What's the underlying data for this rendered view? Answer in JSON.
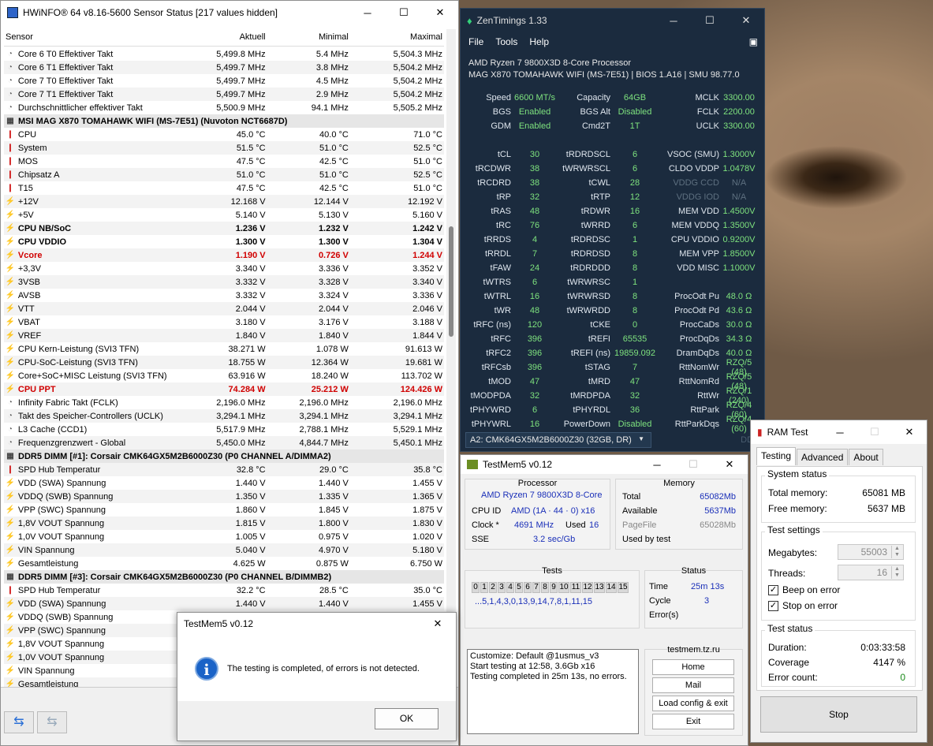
{
  "hwinfo": {
    "title": "HWiNFO® 64 v8.16-5600 Sensor Status [217 values hidden]",
    "columns": [
      "Sensor",
      "Aktuell",
      "Minimal",
      "Maximal"
    ],
    "rows": [
      {
        "t": "clock",
        "name": "Core 6 T0 Effektiver Takt",
        "a": "5,499.8 MHz",
        "b": "5.4 MHz",
        "c": "5,504.3 MHz"
      },
      {
        "t": "clock",
        "name": "Core 6 T1 Effektiver Takt",
        "a": "5,499.7 MHz",
        "b": "3.8 MHz",
        "c": "5,504.2 MHz"
      },
      {
        "t": "clock",
        "name": "Core 7 T0 Effektiver Takt",
        "a": "5,499.7 MHz",
        "b": "4.5 MHz",
        "c": "5,504.2 MHz"
      },
      {
        "t": "clock",
        "name": "Core 7 T1 Effektiver Takt",
        "a": "5,499.7 MHz",
        "b": "2.9 MHz",
        "c": "5,504.2 MHz"
      },
      {
        "t": "clock",
        "name": "Durchschnittlicher effektiver Takt",
        "a": "5,500.9 MHz",
        "b": "94.1 MHz",
        "c": "5,505.2 MHz"
      },
      {
        "t": "hdr",
        "name": "MSI MAG X870 TOMAHAWK WIFI (MS-7E51) (Nuvoton NCT6687D)",
        "a": "",
        "b": "",
        "c": ""
      },
      {
        "t": "temp",
        "name": "CPU",
        "a": "45.0 °C",
        "b": "40.0 °C",
        "c": "71.0 °C"
      },
      {
        "t": "temp",
        "name": "System",
        "a": "51.5 °C",
        "b": "51.0 °C",
        "c": "52.5 °C"
      },
      {
        "t": "temp",
        "name": "MOS",
        "a": "47.5 °C",
        "b": "42.5 °C",
        "c": "51.0 °C"
      },
      {
        "t": "temp",
        "name": "Chipsatz A",
        "a": "51.0 °C",
        "b": "51.0 °C",
        "c": "52.5 °C"
      },
      {
        "t": "temp",
        "name": "T15",
        "a": "47.5 °C",
        "b": "42.5 °C",
        "c": "51.0 °C"
      },
      {
        "t": "volt",
        "name": "+12V",
        "a": "12.168 V",
        "b": "12.144 V",
        "c": "12.192 V"
      },
      {
        "t": "volt",
        "name": "+5V",
        "a": "5.140 V",
        "b": "5.130 V",
        "c": "5.160 V"
      },
      {
        "t": "volt",
        "s": "bold",
        "name": "CPU NB/SoC",
        "a": "1.236 V",
        "b": "1.232 V",
        "c": "1.242 V"
      },
      {
        "t": "volt",
        "s": "bold",
        "name": "CPU VDDIO",
        "a": "1.300 V",
        "b": "1.300 V",
        "c": "1.304 V"
      },
      {
        "t": "volt",
        "s": "red",
        "name": "Vcore",
        "a": "1.190 V",
        "b": "0.726 V",
        "c": "1.244 V"
      },
      {
        "t": "volt",
        "name": "+3,3V",
        "a": "3.340 V",
        "b": "3.336 V",
        "c": "3.352 V"
      },
      {
        "t": "volt",
        "name": "3VSB",
        "a": "3.332 V",
        "b": "3.328 V",
        "c": "3.340 V"
      },
      {
        "t": "volt",
        "name": "AVSB",
        "a": "3.332 V",
        "b": "3.324 V",
        "c": "3.336 V"
      },
      {
        "t": "volt",
        "name": "VTT",
        "a": "2.044 V",
        "b": "2.044 V",
        "c": "2.046 V"
      },
      {
        "t": "volt",
        "name": "VBAT",
        "a": "3.180 V",
        "b": "3.176 V",
        "c": "3.188 V"
      },
      {
        "t": "volt",
        "name": "VREF",
        "a": "1.840 V",
        "b": "1.840 V",
        "c": "1.844 V"
      },
      {
        "t": "volt",
        "name": "CPU Kern-Leistung (SVI3 TFN)",
        "a": "38.271 W",
        "b": "1.078 W",
        "c": "91.613 W"
      },
      {
        "t": "volt",
        "name": "CPU-SoC-Leistung (SVI3 TFN)",
        "a": "18.755 W",
        "b": "12.364 W",
        "c": "19.681 W"
      },
      {
        "t": "volt",
        "name": "Core+SoC+MISC Leistung (SVI3 TFN)",
        "a": "63.916 W",
        "b": "18.240 W",
        "c": "113.702 W"
      },
      {
        "t": "volt",
        "s": "red",
        "name": "CPU PPT",
        "a": "74.284 W",
        "b": "25.212 W",
        "c": "124.426 W"
      },
      {
        "t": "clock",
        "name": "Infinity Fabric Takt (FCLK)",
        "a": "2,196.0 MHz",
        "b": "2,196.0 MHz",
        "c": "2,196.0 MHz"
      },
      {
        "t": "clock",
        "name": "Takt des Speicher-Controllers (UCLK)",
        "a": "3,294.1 MHz",
        "b": "3,294.1 MHz",
        "c": "3,294.1 MHz"
      },
      {
        "t": "clock",
        "name": "L3 Cache (CCD1)",
        "a": "5,517.9 MHz",
        "b": "2,788.1 MHz",
        "c": "5,529.1 MHz"
      },
      {
        "t": "clock",
        "name": "Frequenzgrenzwert - Global",
        "a": "5,450.0 MHz",
        "b": "4,844.7 MHz",
        "c": "5,450.1 MHz"
      },
      {
        "t": "hdr",
        "name": "DDR5 DIMM [#1]: Corsair CMK64GX5M2B6000Z30 (P0 CHANNEL A/DIMMA2)",
        "a": "",
        "b": "",
        "c": ""
      },
      {
        "t": "temp",
        "name": "SPD Hub Temperatur",
        "a": "32.8 °C",
        "b": "29.0 °C",
        "c": "35.8 °C"
      },
      {
        "t": "volt",
        "name": "VDD (SWA) Spannung",
        "a": "1.440 V",
        "b": "1.440 V",
        "c": "1.455 V"
      },
      {
        "t": "volt",
        "name": "VDDQ (SWB) Spannung",
        "a": "1.350 V",
        "b": "1.335 V",
        "c": "1.365 V"
      },
      {
        "t": "volt",
        "name": "VPP (SWC) Spannung",
        "a": "1.860 V",
        "b": "1.845 V",
        "c": "1.875 V"
      },
      {
        "t": "volt",
        "name": "1,8V VOUT Spannung",
        "a": "1.815 V",
        "b": "1.800 V",
        "c": "1.830 V"
      },
      {
        "t": "volt",
        "name": "1,0V VOUT Spannung",
        "a": "1.005 V",
        "b": "0.975 V",
        "c": "1.020 V"
      },
      {
        "t": "volt",
        "name": "VIN Spannung",
        "a": "5.040 V",
        "b": "4.970 V",
        "c": "5.180 V"
      },
      {
        "t": "volt",
        "name": "Gesamtleistung",
        "a": "4.625 W",
        "b": "0.875 W",
        "c": "6.750 W"
      },
      {
        "t": "hdr",
        "name": "DDR5 DIMM [#3]: Corsair CMK64GX5M2B6000Z30 (P0 CHANNEL B/DIMMB2)",
        "a": "",
        "b": "",
        "c": ""
      },
      {
        "t": "temp",
        "name": "SPD Hub Temperatur",
        "a": "32.2 °C",
        "b": "28.5 °C",
        "c": "35.0 °C"
      },
      {
        "t": "volt",
        "name": "VDD (SWA) Spannung",
        "a": "1.440 V",
        "b": "1.440 V",
        "c": "1.455 V"
      },
      {
        "t": "volt",
        "name": "VDDQ (SWB) Spannung",
        "a": "",
        "b": "",
        "c": ""
      },
      {
        "t": "volt",
        "name": "VPP (SWC) Spannung",
        "a": "",
        "b": "",
        "c": ""
      },
      {
        "t": "volt",
        "name": "1,8V VOUT Spannung",
        "a": "",
        "b": "",
        "c": ""
      },
      {
        "t": "volt",
        "name": "1,0V VOUT Spannung",
        "a": "",
        "b": "",
        "c": ""
      },
      {
        "t": "volt",
        "name": "VIN Spannung",
        "a": "",
        "b": "",
        "c": ""
      },
      {
        "t": "volt",
        "name": "Gesamtleistung",
        "a": "",
        "b": "",
        "c": ""
      }
    ]
  },
  "zen": {
    "title": "ZenTimings 1.33",
    "menu": [
      "File",
      "Tools",
      "Help"
    ],
    "cpu": "AMD Ryzen 7 9800X3D 8-Core Processor",
    "board": "MAG X870 TOMAHAWK WIFI (MS-7E51) | BIOS 1.A16 | SMU 98.77.0",
    "rows": [
      [
        "Speed",
        "6600 MT/s",
        "Capacity",
        "64GB",
        "MCLK",
        "3300.00"
      ],
      [
        "BGS",
        "Enabled",
        "BGS Alt",
        "Disabled",
        "FCLK",
        "2200.00"
      ],
      [
        "GDM",
        "Enabled",
        "Cmd2T",
        "1T",
        "UCLK",
        "3300.00"
      ],
      [
        "",
        "",
        "",
        "",
        "",
        ""
      ],
      [
        "tCL",
        "30",
        "tRDRDSCL",
        "6",
        "VSOC (SMU)",
        "1.3000V"
      ],
      [
        "tRCDWR",
        "38",
        "tWRWRSCL",
        "6",
        "CLDO VDDP",
        "1.0478V"
      ],
      [
        "tRCDRD",
        "38",
        "tCWL",
        "28",
        "VDDG CCD",
        "N/A"
      ],
      [
        "tRP",
        "32",
        "tRTP",
        "12",
        "VDDG IOD",
        "N/A"
      ],
      [
        "tRAS",
        "48",
        "tRDWR",
        "16",
        "MEM VDD",
        "1.4500V"
      ],
      [
        "tRC",
        "76",
        "tWRRD",
        "6",
        "MEM VDDQ",
        "1.3500V"
      ],
      [
        "tRRDS",
        "4",
        "tRDRDSC",
        "1",
        "CPU VDDIO",
        "0.9200V"
      ],
      [
        "tRRDL",
        "7",
        "tRDRDSD",
        "8",
        "MEM VPP",
        "1.8500V"
      ],
      [
        "tFAW",
        "24",
        "tRDRDDD",
        "8",
        "VDD MISC",
        "1.1000V"
      ],
      [
        "tWTRS",
        "6",
        "tWRWRSC",
        "1",
        "",
        ""
      ],
      [
        "tWTRL",
        "16",
        "tWRWRSD",
        "8",
        "ProcOdt Pu",
        "48.0 Ω"
      ],
      [
        "tWR",
        "48",
        "tWRWRDD",
        "8",
        "ProcOdt Pd",
        "43.6 Ω"
      ],
      [
        "tRFC (ns)",
        "120",
        "tCKE",
        "0",
        "ProcCaDs",
        "30.0 Ω"
      ],
      [
        "tRFC",
        "396",
        "tREFI",
        "65535",
        "ProcDqDs",
        "34.3 Ω"
      ],
      [
        "tRFC2",
        "396",
        "tREFI (ns)",
        "19859.092",
        "DramDqDs",
        "40.0 Ω"
      ],
      [
        "tRFCsb",
        "396",
        "tSTAG",
        "7",
        "RttNomWr",
        "RZQ/5 (48)"
      ],
      [
        "tMOD",
        "47",
        "tMRD",
        "47",
        "RttNomRd",
        "RZQ/5 (48)"
      ],
      [
        "tMODPDA",
        "32",
        "tMRDPDA",
        "32",
        "RttWr",
        "RZQ/1 (240)"
      ],
      [
        "tPHYWRD",
        "6",
        "tPHYRDL",
        "36",
        "RttPark",
        "RZQ/4 (60)"
      ],
      [
        "tPHYWRL",
        "16",
        "PowerDown",
        "Disabled",
        "RttParkDqs",
        "RZQ/4 (60)"
      ]
    ],
    "module": "A2: CMK64GX5M2B6000Z30 (32GB, DR)",
    "ddr": "DDR"
  },
  "tm": {
    "title": "TestMem5 v0.12",
    "proc_cap": "Processor",
    "proc_name": "AMD Ryzen 7 9800X3D 8-Core",
    "cpuid_l": "CPU ID",
    "cpuid_v": "AMD  (1A · 44 · 0)  x16",
    "clock_l": "Clock *",
    "clock_v": "4691 MHz",
    "used_l": "Used",
    "used_v": "16",
    "sse_l": "SSE",
    "sse_v": "3.2 sec/Gb",
    "mem_cap": "Memory",
    "total_l": "Total",
    "total_v": "65082Mb",
    "avail_l": "Available",
    "avail_v": "5637Mb",
    "page_l": "PageFile",
    "page_v": "65028Mb",
    "usedby": "Used by test",
    "tests_cap": "Tests",
    "tests": [
      "0",
      "1",
      "2",
      "3",
      "4",
      "5",
      "6",
      "7",
      "8",
      "9",
      "10",
      "11",
      "12",
      "13",
      "14",
      "15"
    ],
    "seq": "...5,1,4,3,0,13,9,14,7,8,1,11,15",
    "status_cap": "Status",
    "time_l": "Time",
    "time_v": "25m 13s",
    "cycle_l": "Cycle",
    "cycle_v": "3",
    "err_l": "Error(s)",
    "log": [
      "Customize: Default @1usmus_v3",
      "Start testing at 12:58, 3.6Gb x16",
      "Testing completed in 25m 13s, no errors."
    ],
    "site": "testmem.tz.ru",
    "buttons": [
      "Home",
      "Mail",
      "Load config & exit",
      "Exit"
    ]
  },
  "dialog": {
    "title": "TestMem5 v0.12",
    "message": "The testing is completed, of errors is not detected.",
    "ok": "OK",
    "icon": "i"
  },
  "ram": {
    "title": "RAM Test",
    "tabs": [
      "Testing",
      "Advanced",
      "About"
    ],
    "sys_cap": "System status",
    "total_l": "Total memory:",
    "total_v": "65081 MB",
    "free_l": "Free memory:",
    "free_v": "5637 MB",
    "set_cap": "Test settings",
    "mb_l": "Megabytes:",
    "mb_v": "55003",
    "thr_l": "Threads:",
    "thr_v": "16",
    "beep": "Beep on error",
    "stop_err": "Stop on error",
    "st_cap": "Test status",
    "dur_l": "Duration:",
    "dur_v": "0:03:33:58",
    "cov_l": "Coverage",
    "cov_v": "4147 %",
    "ec_l": "Error count:",
    "ec_v": "0",
    "stop": "Stop",
    "ok_color": "#1a8a1a"
  }
}
